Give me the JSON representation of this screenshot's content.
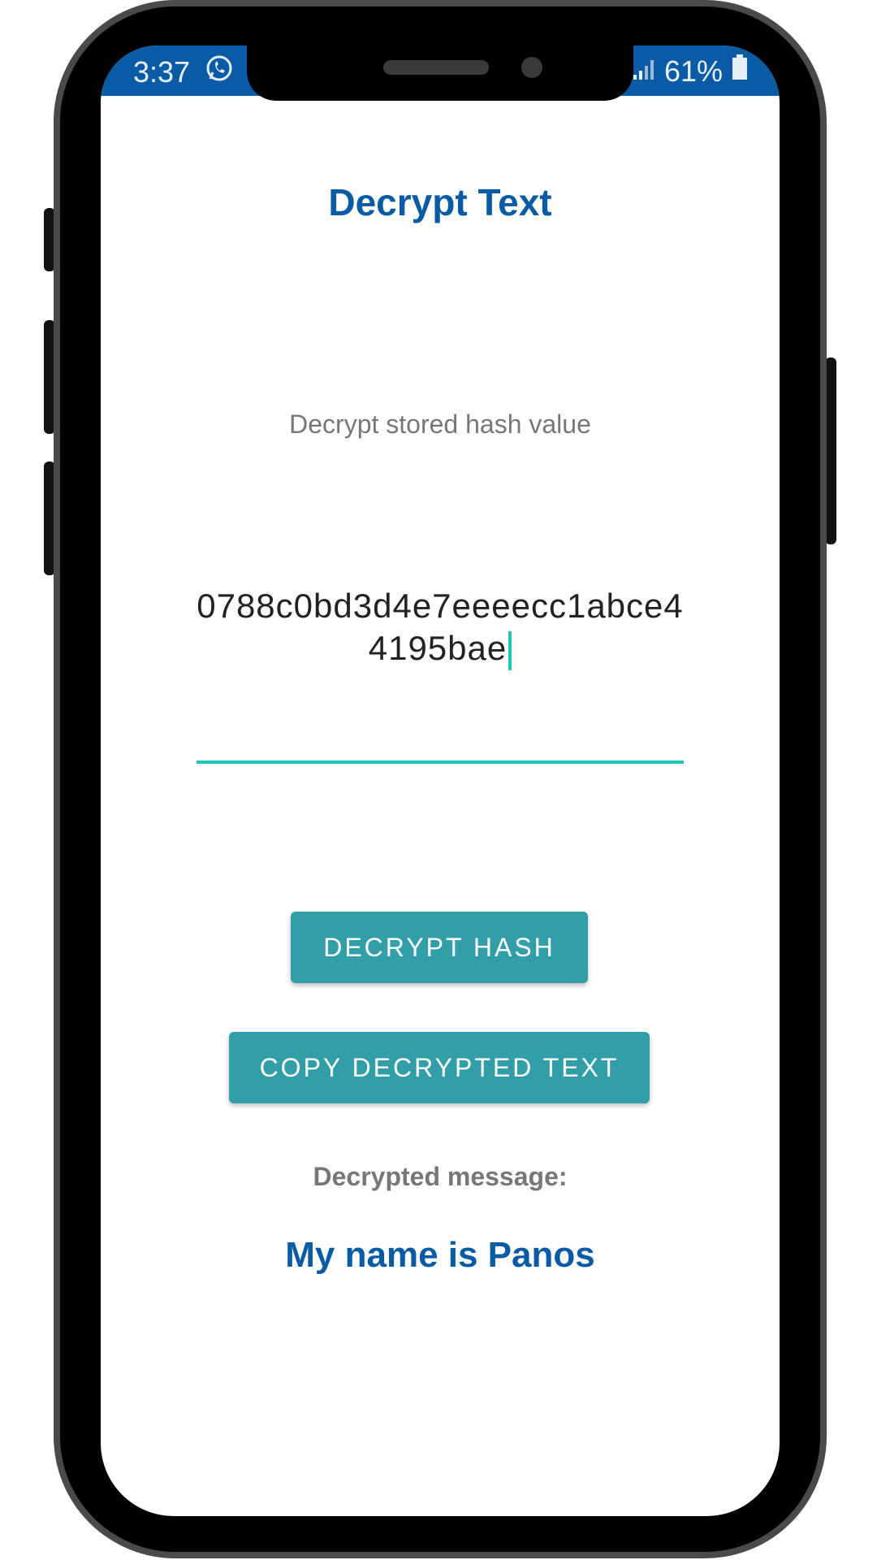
{
  "status_bar": {
    "time": "3:37",
    "battery": "61%"
  },
  "icons": {
    "messaging": "whatsapp-icon",
    "signal": "signal-icon",
    "battery": "battery-icon"
  },
  "colors": {
    "primary": "#0a5ba6",
    "button": "#329fa8",
    "accent": "#1fc7b5"
  },
  "screen": {
    "title": "Decrypt Text",
    "subtitle": "Decrypt stored hash value",
    "hash_value": "0788c0bd3d4e7eeeecc1abce44195bae",
    "decrypt_button": "DECRYPT HASH",
    "copy_button": "COPY DECRYPTED TEXT",
    "result_label": "Decrypted message:",
    "result_value": "My name is Panos"
  }
}
